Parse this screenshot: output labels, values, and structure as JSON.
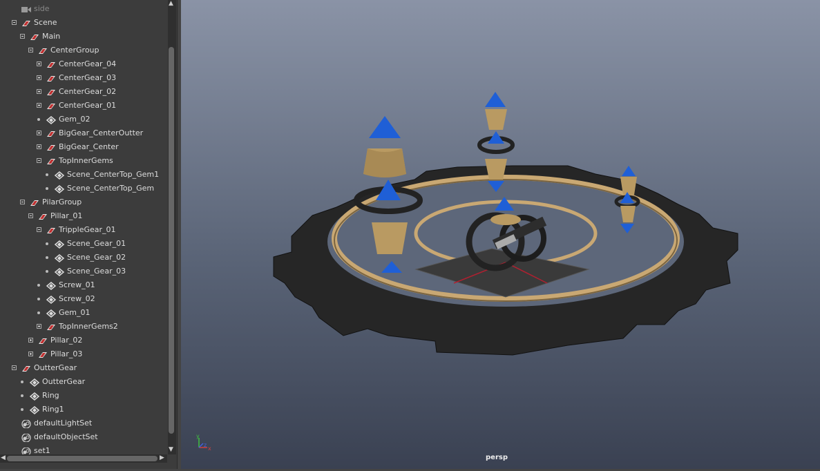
{
  "outliner": {
    "items": [
      {
        "label": "side",
        "icon": "camera-icon",
        "level": 1,
        "toggle": "none",
        "muted": true
      },
      {
        "label": "Scene",
        "icon": "transform-icon",
        "level": 1,
        "toggle": "minus"
      },
      {
        "label": "Main",
        "icon": "transform-icon",
        "level": 2,
        "toggle": "minus"
      },
      {
        "label": "CenterGroup",
        "icon": "transform-icon",
        "level": 3,
        "toggle": "minus"
      },
      {
        "label": "CenterGear_04",
        "icon": "transform-icon",
        "level": 4,
        "toggle": "plus"
      },
      {
        "label": "CenterGear_03",
        "icon": "transform-icon",
        "level": 4,
        "toggle": "plus"
      },
      {
        "label": "CenterGear_02",
        "icon": "transform-icon",
        "level": 4,
        "toggle": "plus"
      },
      {
        "label": "CenterGear_01",
        "icon": "transform-icon",
        "level": 4,
        "toggle": "plus"
      },
      {
        "label": "Gem_02",
        "icon": "mesh-icon",
        "level": 4,
        "toggle": "dot"
      },
      {
        "label": "BigGear_CenterOutter",
        "icon": "transform-icon",
        "level": 4,
        "toggle": "plus"
      },
      {
        "label": "BigGear_Center",
        "icon": "transform-icon",
        "level": 4,
        "toggle": "plus"
      },
      {
        "label": "TopInnerGems",
        "icon": "transform-icon",
        "level": 4,
        "toggle": "minus"
      },
      {
        "label": "Scene_CenterTop_Gem1",
        "icon": "mesh-icon",
        "level": 5,
        "toggle": "dot"
      },
      {
        "label": "Scene_CenterTop_Gem",
        "icon": "mesh-icon",
        "level": 5,
        "toggle": "dot"
      },
      {
        "label": "PilarGroup",
        "icon": "transform-icon",
        "level": 2,
        "toggle": "minus"
      },
      {
        "label": "Pillar_01",
        "icon": "transform-icon",
        "level": 3,
        "toggle": "minus"
      },
      {
        "label": "TrippleGear_01",
        "icon": "transform-icon",
        "level": 4,
        "toggle": "minus"
      },
      {
        "label": "Scene_Gear_01",
        "icon": "mesh-icon",
        "level": 5,
        "toggle": "dot"
      },
      {
        "label": "Scene_Gear_02",
        "icon": "mesh-icon",
        "level": 5,
        "toggle": "dot"
      },
      {
        "label": "Scene_Gear_03",
        "icon": "mesh-icon",
        "level": 5,
        "toggle": "dot"
      },
      {
        "label": "Screw_01",
        "icon": "mesh-icon",
        "level": 4,
        "toggle": "dot"
      },
      {
        "label": "Screw_02",
        "icon": "mesh-icon",
        "level": 4,
        "toggle": "dot"
      },
      {
        "label": "Gem_01",
        "icon": "mesh-icon",
        "level": 4,
        "toggle": "dot"
      },
      {
        "label": "TopInnerGems2",
        "icon": "transform-icon",
        "level": 4,
        "toggle": "plus"
      },
      {
        "label": "Pillar_02",
        "icon": "transform-icon",
        "level": 3,
        "toggle": "plus"
      },
      {
        "label": "Pillar_03",
        "icon": "transform-icon",
        "level": 3,
        "toggle": "plus"
      },
      {
        "label": "OutterGear",
        "icon": "transform-icon",
        "level": 1,
        "toggle": "minus"
      },
      {
        "label": "OutterGear",
        "icon": "mesh-icon",
        "level": 2,
        "toggle": "dot"
      },
      {
        "label": "Ring",
        "icon": "mesh-icon",
        "level": 2,
        "toggle": "dot"
      },
      {
        "label": "Ring1",
        "icon": "mesh-icon",
        "level": 2,
        "toggle": "dot"
      },
      {
        "label": "defaultLightSet",
        "icon": "set-icon",
        "level": 1,
        "toggle": "none"
      },
      {
        "label": "defaultObjectSet",
        "icon": "set-icon",
        "level": 1,
        "toggle": "none"
      },
      {
        "label": "set1",
        "icon": "set-icon",
        "level": 1,
        "toggle": "none"
      }
    ]
  },
  "viewport": {
    "camera_label": "persp",
    "axis_labels": {
      "x": "x",
      "y": "y",
      "z": "z"
    },
    "colors": {
      "gem": "#1f5fd6",
      "gold": "#b99a62",
      "gear": "#262626",
      "ring": "#c9a873",
      "grid_red": "#b02030"
    }
  }
}
